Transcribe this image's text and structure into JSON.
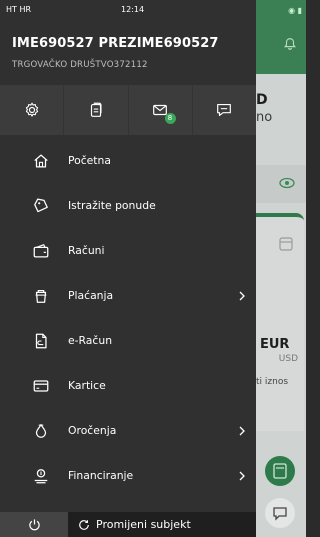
{
  "status_bar": {
    "left": "HT HR",
    "time": "12:14"
  },
  "user": {
    "name": "IME690527 PREZIME690527",
    "company": "TRGOVAČKO DRUŠTVO372112"
  },
  "quick_actions": [
    {
      "icon": "gear-icon"
    },
    {
      "icon": "document-icon"
    },
    {
      "icon": "mail-icon",
      "badge": "8"
    },
    {
      "icon": "chat-icon"
    }
  ],
  "menu": [
    {
      "label": "Početna",
      "icon": "home-icon",
      "has_chevron": false
    },
    {
      "label": "Istražite ponude",
      "icon": "tag-icon",
      "has_chevron": false
    },
    {
      "label": "Računi",
      "icon": "wallet-icon",
      "has_chevron": false
    },
    {
      "label": "Plaćanja",
      "icon": "payment-icon",
      "has_chevron": true
    },
    {
      "label": "e-Račun",
      "icon": "e-invoice-icon",
      "has_chevron": false
    },
    {
      "label": "Kartice",
      "icon": "card-icon",
      "has_chevron": false
    },
    {
      "label": "Oročenja",
      "icon": "deposit-icon",
      "has_chevron": true
    },
    {
      "label": "Financiranje",
      "icon": "financing-icon",
      "has_chevron": true
    }
  ],
  "bottom": {
    "switch_label": "Promijeni subjekt"
  },
  "background": {
    "text_d": "D",
    "text_no": "no",
    "currency": "EUR",
    "secondary_currency": "USD",
    "amount_label": "ti iznos"
  },
  "colors": {
    "drawer_bg": "#303030",
    "quick_bar_bg": "#3c3c3c",
    "badge_green": "#3aa65a",
    "brand_green": "#2f7a4a"
  }
}
